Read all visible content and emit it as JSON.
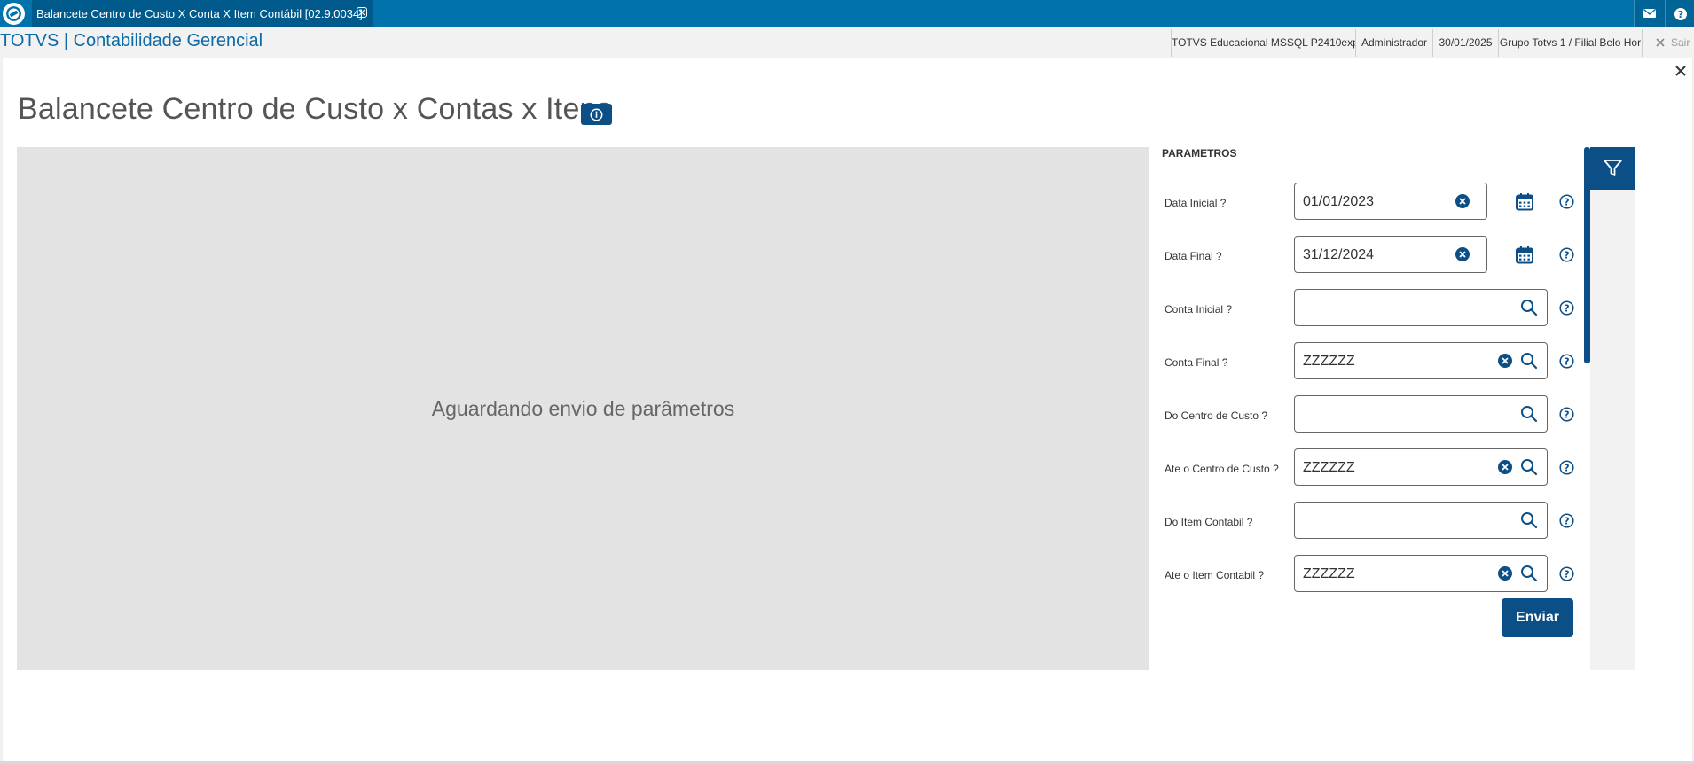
{
  "tab": {
    "title": "Balancete Centro de Custo X Conta X Item Contábil [02.9.0034]"
  },
  "header": {
    "app_title": "TOTVS | Contabilidade Gerencial",
    "environment": "TOTVS Educacional MSSQL P2410exp",
    "user": "Administrador",
    "date": "30/01/2025",
    "branch": "Grupo Totvs 1 / Filial Belo Hor",
    "logout": "Sair"
  },
  "page": {
    "title": "Balancete Centro de Custo x Contas x Itens",
    "preview_message": "Aguardando envio de parâmetros"
  },
  "params": {
    "section_title": "PARAMETROS",
    "fields": [
      {
        "label": "Data Inicial ?",
        "value": "01/01/2023"
      },
      {
        "label": "Data Final ?",
        "value": "31/12/2024"
      },
      {
        "label": "Conta Inicial ?",
        "value": ""
      },
      {
        "label": "Conta Final ?",
        "value": "ZZZZZZ"
      },
      {
        "label": "Do Centro de Custo ?",
        "value": ""
      },
      {
        "label": "Ate o Centro de Custo ?",
        "value": "ZZZZZZ"
      },
      {
        "label": "Do Item Contabil ?",
        "value": ""
      },
      {
        "label": "Ate o Item Contabil ?",
        "value": "ZZZZZZ"
      }
    ],
    "send_label": "Enviar"
  },
  "colors": {
    "topbar": "#0172ab",
    "primary": "#0c4f86",
    "title_link": "#0c6aa6",
    "preview_bg": "#e3e3e3"
  },
  "icons": [
    "totvs-logo-icon",
    "close-icon",
    "mail-icon",
    "help-icon",
    "info-icon",
    "clear-icon",
    "calendar-icon",
    "search-icon",
    "filter-icon"
  ]
}
